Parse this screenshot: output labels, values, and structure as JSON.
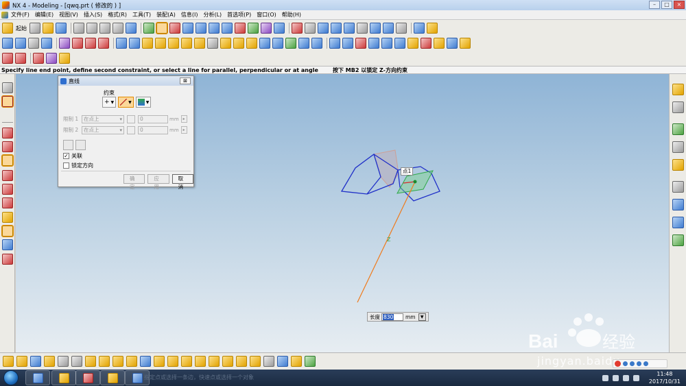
{
  "window": {
    "title": "NX 4 - Modeling - [qwq.prt  ( 修改的 ) ]",
    "minimize": "–",
    "maximize": "□",
    "close": "×"
  },
  "menu": [
    "文件(F)",
    "编辑(E)",
    "视图(V)",
    "插入(S)",
    "格式(R)",
    "工具(T)",
    "装配(A)",
    "信息(I)",
    "分析(L)",
    "首选项(P)",
    "窗口(O)",
    "帮助(H)"
  ],
  "toolbar": {
    "start_label": "起始"
  },
  "status": {
    "prompt": "Specify line end point, define second constraint, or select a line for parallel, perpendicular or at angle",
    "hint": "按下 MB2 以锁定 Z-方向约束"
  },
  "dialog": {
    "title": "直线",
    "close": "⊠",
    "section": "约束",
    "btn_plus": "+",
    "constraint1_label": "限制 1",
    "constraint1_value": "在点上",
    "constraint1_num": "0",
    "constraint2_label": "限制 2",
    "constraint2_value": "在点上",
    "constraint2_num": "0",
    "unit": "mm",
    "associative": "关联",
    "associative_checked": "✓",
    "lock_direction": "锁定方向",
    "ok": "确定",
    "apply": "应用",
    "cancel": "取消"
  },
  "viewport": {
    "point_label": "点1",
    "axis_label": "Z"
  },
  "length_box": {
    "label": "长度",
    "value": "830",
    "unit": "mm"
  },
  "taskbar": {
    "time": "11:48",
    "date": "2017/10/31",
    "ghost": "指定点或选择一条边，快速点或选择一个对象"
  },
  "watermark": {
    "brand": "Bai",
    "brand_cn": "经验",
    "url": "jingyan.baidu"
  },
  "colors": {
    "pentagon": "#1f2fc8",
    "line": "#f07a1a",
    "green_plane": "#2fa84a"
  }
}
